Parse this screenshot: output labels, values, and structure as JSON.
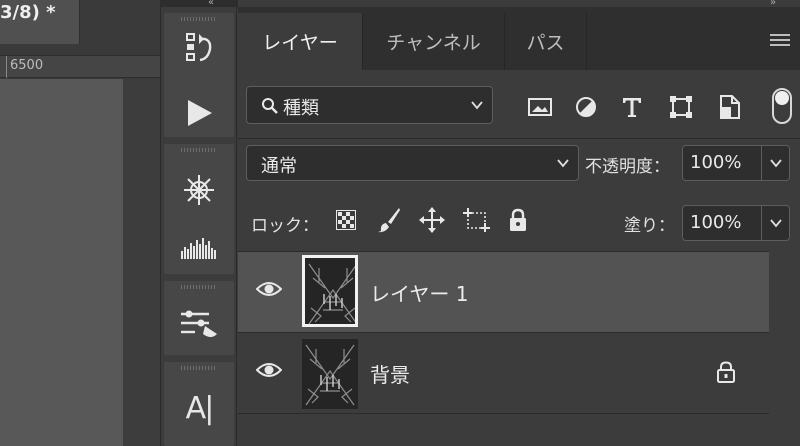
{
  "document": {
    "tab_title": "3/8) *",
    "ruler_label": "6500"
  },
  "toolstrip": {
    "collapse_left": "«",
    "collapse_right": "»",
    "tools": [
      "history-icon",
      "play-action-icon",
      "navigator-wheel-icon",
      "histogram-icon",
      "adjustments-icon",
      "character-type-icon"
    ],
    "character_glyph": "A|"
  },
  "panel": {
    "tabs": [
      {
        "label": "レイヤー",
        "active": true
      },
      {
        "label": "チャンネル",
        "active": false
      },
      {
        "label": "パス",
        "active": false
      }
    ],
    "filter": {
      "selected": "種類"
    },
    "blend_mode": {
      "selected": "通常"
    },
    "opacity": {
      "label": "不透明度：",
      "value": "100%"
    },
    "lock": {
      "label": "ロック："
    },
    "fill": {
      "label": "塗り：",
      "value": "100%"
    },
    "layers": [
      {
        "name": "レイヤー 1",
        "visible": true,
        "selected": true,
        "locked": false
      },
      {
        "name": "背景",
        "visible": true,
        "selected": false,
        "locked": true
      }
    ]
  },
  "colors": {
    "panel_bg": "#3c3c3c",
    "tab_bar_bg": "#2f2f2f",
    "selected_row": "#535353",
    "field_bg": "#2e2e2e",
    "text": "#e6e6e6"
  }
}
